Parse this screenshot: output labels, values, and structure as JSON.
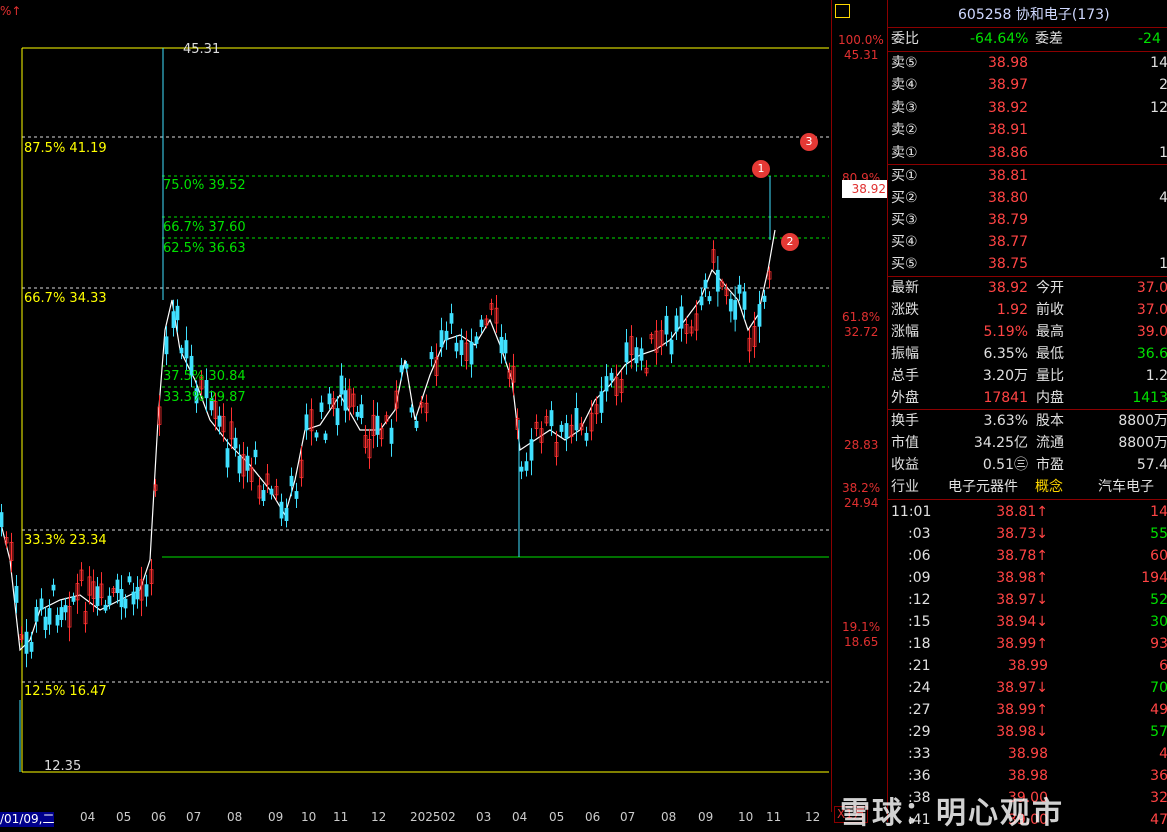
{
  "header": {
    "corner": "%↑"
  },
  "fib_levels": [
    {
      "label": "45.31",
      "color": "#ffff00"
    },
    {
      "label": "87.5% 41.19",
      "color": "#ffff00"
    },
    {
      "label": "75.0% 39.52",
      "color": "#00e000"
    },
    {
      "label": "66.7% 37.60",
      "color": "#00e000"
    },
    {
      "label": "62.5% 36.63",
      "color": "#00e000"
    },
    {
      "label": "66.7% 34.33",
      "color": "#ffff00"
    },
    {
      "label": "37.5% 30.84",
      "color": "#00e000"
    },
    {
      "label": "33.3% 29.87",
      "color": "#00e000"
    },
    {
      "label": "33.3% 23.34",
      "color": "#ffff00"
    },
    {
      "label": "12.5% 16.47",
      "color": "#ffff00"
    },
    {
      "label": "12.35",
      "color": "#cccccc"
    }
  ],
  "markers": [
    "1",
    "2",
    "3"
  ],
  "right_scale": [
    "100.0%",
    "45.31",
    "80.9%",
    "38.92",
    "61.8%",
    "32.72",
    "28.83",
    "38.2%",
    "24.94",
    "19.1%",
    "18.65"
  ],
  "date_axis": [
    "/01/09,二",
    "04",
    "05",
    "06",
    "07",
    "08",
    "09",
    "10",
    "11",
    "12",
    "202502",
    "03",
    "04",
    "05",
    "06",
    "07",
    "08",
    "09",
    "10",
    "11",
    "12"
  ],
  "axis_unit": "X1万",
  "panel": {
    "title": "605258 协和电子(173)",
    "weibi_label": "委比",
    "weibi": "-64.64%",
    "weicha_label": "委差",
    "weicha": "-24",
    "sell": [
      {
        "label": "卖⑤",
        "price": "38.98",
        "vol": "14"
      },
      {
        "label": "卖④",
        "price": "38.97",
        "vol": "2"
      },
      {
        "label": "卖③",
        "price": "38.92",
        "vol": "12"
      },
      {
        "label": "卖②",
        "price": "38.91",
        "vol": ""
      },
      {
        "label": "卖①",
        "price": "38.86",
        "vol": "1"
      }
    ],
    "buy": [
      {
        "label": "买①",
        "price": "38.81",
        "vol": ""
      },
      {
        "label": "买②",
        "price": "38.80",
        "vol": "4"
      },
      {
        "label": "买③",
        "price": "38.79",
        "vol": ""
      },
      {
        "label": "买④",
        "price": "38.77",
        "vol": ""
      },
      {
        "label": "买⑤",
        "price": "38.75",
        "vol": "1"
      }
    ],
    "stats": [
      {
        "l1": "最新",
        "v1": "38.92",
        "l2": "今开",
        "v2": "37.0"
      },
      {
        "l1": "涨跌",
        "v1": "1.92",
        "l2": "前收",
        "v2": "37.0"
      },
      {
        "l1": "涨幅",
        "v1": "5.19%",
        "l2": "最高",
        "v2": "39.0"
      },
      {
        "l1": "振幅",
        "v1": "6.35%",
        "l2": "最低",
        "v2": "36.6"
      },
      {
        "l1": "总手",
        "v1": "3.20万",
        "l2": "量比",
        "v2": "1.2"
      },
      {
        "l1": "外盘",
        "v1": "17841",
        "l2": "内盘",
        "v2": "1413"
      }
    ],
    "info": [
      {
        "l1": "换手",
        "v1": "3.63%",
        "l2": "股本",
        "v2": "8800万"
      },
      {
        "l1": "市值",
        "v1": "34.25亿",
        "l2": "流通",
        "v2": "8800万"
      },
      {
        "l1": "收益",
        "v1": "0.51㊂",
        "l2": "市盈",
        "v2": "57.4"
      }
    ],
    "industry": {
      "l1": "行业",
      "v1": "电子元器件",
      "l2": "概念",
      "v2": "汽车电子"
    },
    "ticks": [
      {
        "t": "11:01",
        "p": "38.81↑",
        "v": "14",
        "dir": "up"
      },
      {
        "t": ":03",
        "p": "38.73↓",
        "v": "55",
        "dir": "down"
      },
      {
        "t": ":06",
        "p": "38.78↑",
        "v": "60",
        "dir": "up"
      },
      {
        "t": ":09",
        "p": "38.98↑",
        "v": "194",
        "dir": "up"
      },
      {
        "t": ":12",
        "p": "38.97↓",
        "v": "52",
        "dir": "down"
      },
      {
        "t": ":15",
        "p": "38.94↓",
        "v": "30",
        "dir": "down"
      },
      {
        "t": ":18",
        "p": "38.99↑",
        "v": "93",
        "dir": "up"
      },
      {
        "t": ":21",
        "p": "38.99",
        "v": "6",
        "dir": "up"
      },
      {
        "t": ":24",
        "p": "38.97↓",
        "v": "70",
        "dir": "down"
      },
      {
        "t": ":27",
        "p": "38.99↑",
        "v": "49",
        "dir": "up"
      },
      {
        "t": ":29",
        "p": "38.98↓",
        "v": "57",
        "dir": "down"
      },
      {
        "t": ":33",
        "p": "38.98",
        "v": "4",
        "dir": "up"
      },
      {
        "t": ":36",
        "p": "38.98",
        "v": "36",
        "dir": "up"
      },
      {
        "t": ":38",
        "p": "39.00",
        "v": "32",
        "dir": "up"
      },
      {
        "t": ":41",
        "p": "39.00",
        "v": "47",
        "dir": "up"
      }
    ]
  },
  "current_price_tag": "38.92",
  "watermark": "雪球：明心观市"
}
